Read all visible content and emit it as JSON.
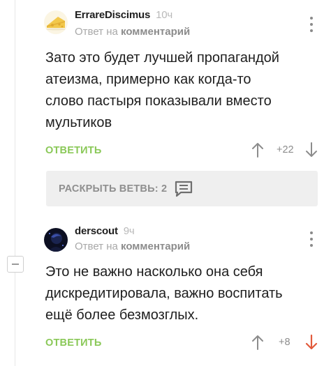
{
  "comments": [
    {
      "author": "ErrareDiscimus",
      "time": "10ч",
      "reply_prefix": "Ответ на",
      "reply_target": "комментарий",
      "text": "Зато это будет лучшей пропагандой\nатеизма, примерно как когда-то\nслово пастыря показывали вместо\nмультиков",
      "reply_label": "ОТВЕТИТЬ",
      "votes": "+22",
      "avatar_icon": "cheese-avatar-icon",
      "voted_down": false
    },
    {
      "author": "derscout",
      "time": "9ч",
      "reply_prefix": "Ответ на",
      "reply_target": "комментарий",
      "text": "Это не важно насколько она себя\nдискредитировала, важно воспитать\nещё более безмозглых.",
      "reply_label": "ОТВЕТИТЬ",
      "votes": "+8",
      "avatar_icon": "dark-avatar-icon",
      "voted_down": true
    }
  ],
  "expand_branch": {
    "label": "РАСКРЫТЬ ВЕТВЬ: 2",
    "icon": "comments-icon"
  },
  "colors": {
    "accent_green": "#8ac858",
    "downvote_active": "#e25b3c",
    "vote_neutral": "#8c8c8c"
  }
}
